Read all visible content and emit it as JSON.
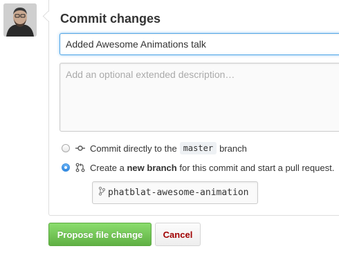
{
  "commit": {
    "heading": "Commit changes",
    "summary_value": "Added Awesome Animations talk",
    "description_placeholder": "Add an optional extended description…"
  },
  "options": {
    "direct": {
      "text_before": "Commit directly to the",
      "branch": "master",
      "text_after": "branch",
      "checked": false
    },
    "new_branch": {
      "text_before": "Create a ",
      "bold": "new branch",
      "text_after": " for this commit and start a pull request.",
      "checked": true
    }
  },
  "new_branch_name": "phatblat-awesome-animation",
  "buttons": {
    "propose": "Propose file change",
    "cancel": "Cancel"
  },
  "icons": {
    "direct": "git-commit-icon",
    "new_branch": "git-pull-request-icon",
    "branch_field": "git-branch-icon"
  },
  "colors": {
    "primary": "#60b044",
    "focus": "#51a7e8",
    "cancel_text": "#a00000",
    "radio_checked": "#2f86e0"
  }
}
